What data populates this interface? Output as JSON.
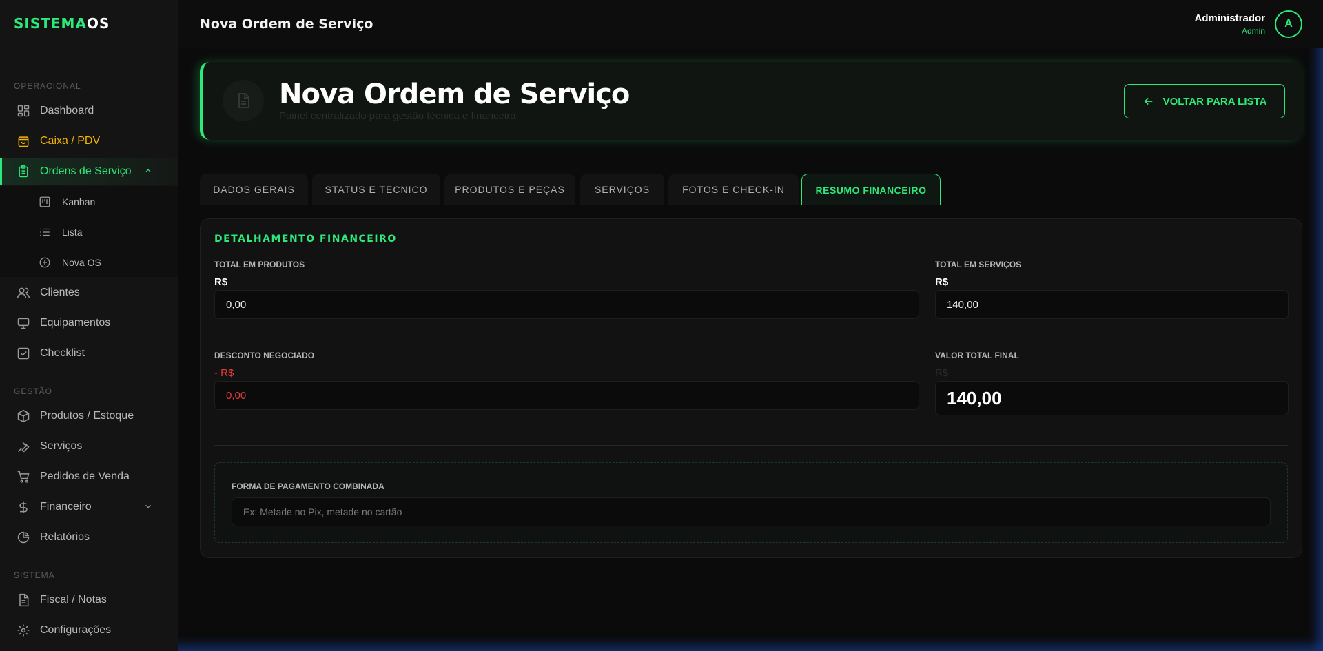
{
  "app": {
    "logo_main": "SISTEMA",
    "logo_suffix": "OS"
  },
  "sidebar": {
    "sections": {
      "operacional": "OPERACIONAL",
      "gestao": "GESTÃO",
      "sistema": "SISTEMA"
    },
    "items": {
      "dashboard": "Dashboard",
      "caixa": "Caixa / PDV",
      "ordens": "Ordens de Serviço",
      "kanban": "Kanban",
      "lista": "Lista",
      "nova_os": "Nova OS",
      "clientes": "Clientes",
      "equipamentos": "Equipamentos",
      "checklist": "Checklist",
      "produtos": "Produtos / Estoque",
      "servicos": "Serviços",
      "pedidos": "Pedidos de Venda",
      "financeiro": "Financeiro",
      "relatorios": "Relatórios",
      "fiscal": "Fiscal / Notas",
      "configuracoes": "Configurações"
    }
  },
  "header": {
    "title": "Nova Ordem de Serviço",
    "user_name": "Administrador",
    "user_role": "Admin",
    "avatar_initial": "A"
  },
  "hero": {
    "title": "Nova Ordem de Serviço",
    "subtitle": "Painel centralizado para gestão técnica e financeira",
    "back_label": "VOLTAR PARA LISTA"
  },
  "tabs": {
    "dados_gerais": "DADOS GERAIS",
    "status_tecnico": "STATUS E TÉCNICO",
    "produtos_pecas": "PRODUTOS E PEÇAS",
    "servicos": "SERVIÇOS",
    "fotos_checkin": "FOTOS E CHECK-IN",
    "resumo_financeiro": "RESUMO FINANCEIRO"
  },
  "finance": {
    "title": "DETALHAMENTO FINANCEIRO",
    "total_produtos_label": "TOTAL EM PRODUTOS",
    "total_produtos_prefix": "R$",
    "total_produtos_value": "0,00",
    "total_servicos_label": "TOTAL EM SERVIÇOS",
    "total_servicos_prefix": "R$",
    "total_servicos_value": "140,00",
    "desconto_label": "DESCONTO NEGOCIADO",
    "desconto_prefix": "- R$",
    "desconto_value": "0,00",
    "valor_total_label": "VALOR TOTAL FINAL",
    "valor_total_prefix": "R$",
    "valor_total_value": "140,00",
    "pagamento_label": "FORMA DE PAGAMENTO COMBINADA",
    "pagamento_placeholder": "Ex: Metade no Pix, metade no cartão"
  },
  "colors": {
    "accent": "#2ee87a",
    "caixa": "#f4b400",
    "discount": "#e23b3b",
    "background": "#0b0b0b"
  }
}
